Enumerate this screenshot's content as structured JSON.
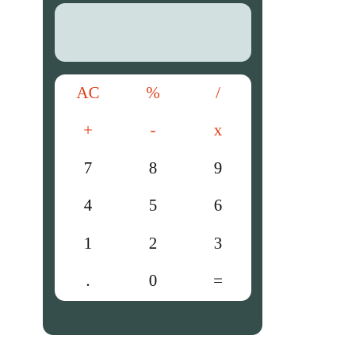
{
  "calculator": {
    "display_value": "",
    "keys": {
      "clear": "AC",
      "percent": "%",
      "divide": "/",
      "plus": "+",
      "minus": "-",
      "multiply": "x",
      "seven": "7",
      "eight": "8",
      "nine": "9",
      "four": "4",
      "five": "5",
      "six": "6",
      "one": "1",
      "two": "2",
      "three": "3",
      "decimal": ".",
      "zero": "0",
      "equals": "="
    }
  },
  "colors": {
    "body": "#354d4b",
    "display": "#d2e0e0",
    "keypad": "#ffffff",
    "operator_text": "#dd3b15",
    "digit_text": "#111111"
  }
}
